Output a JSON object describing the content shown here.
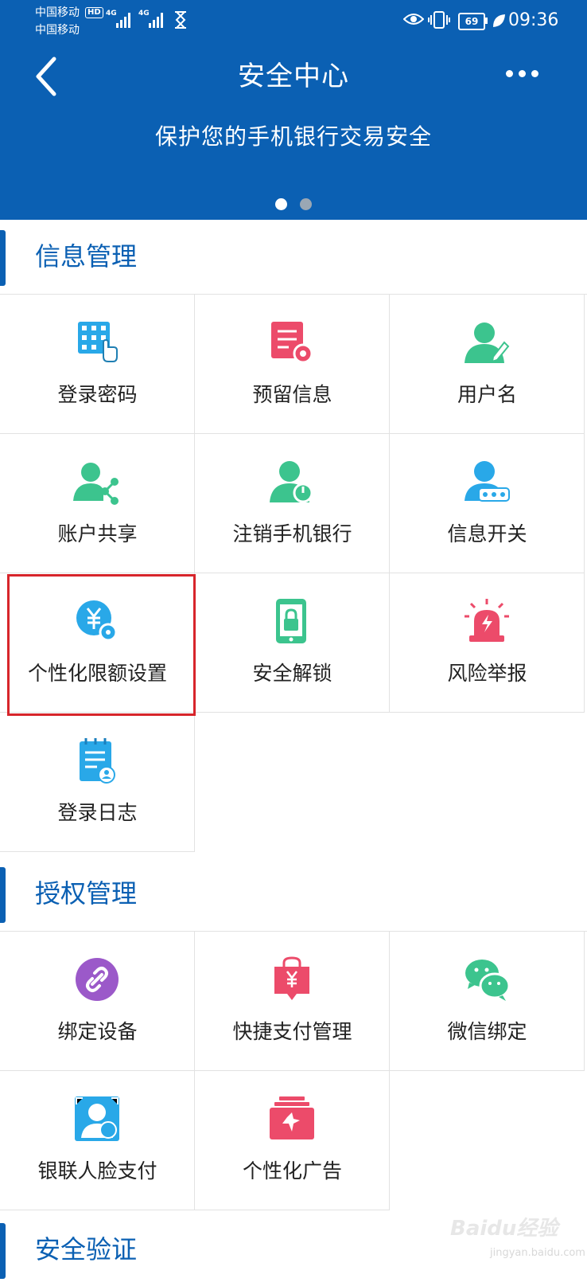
{
  "status_bar": {
    "carrier1": "中国移动",
    "carrier2": "中国移动",
    "hd": "HD",
    "net1": "4G",
    "net2": "4G",
    "battery": "69",
    "time": "09:36"
  },
  "header": {
    "title": "安全中心",
    "banner_text": "保护您的手机银行交易安全"
  },
  "sections": [
    {
      "title": "信息管理",
      "items": [
        {
          "label": "登录密码",
          "icon": "keypad-icon"
        },
        {
          "label": "预留信息",
          "icon": "document-settings-icon"
        },
        {
          "label": "用户名",
          "icon": "user-edit-icon"
        },
        {
          "label": "账户共享",
          "icon": "user-share-icon"
        },
        {
          "label": "注销手机银行",
          "icon": "user-power-icon"
        },
        {
          "label": "信息开关",
          "icon": "user-password-icon"
        },
        {
          "label": "个性化限额设置",
          "icon": "yuan-settings-icon"
        },
        {
          "label": "安全解锁",
          "icon": "phone-lock-icon"
        },
        {
          "label": "风险举报",
          "icon": "alarm-icon"
        },
        {
          "label": "登录日志",
          "icon": "log-notebook-icon"
        }
      ]
    },
    {
      "title": "授权管理",
      "items": [
        {
          "label": "绑定设备",
          "icon": "link-icon"
        },
        {
          "label": "快捷支付管理",
          "icon": "shopping-bag-icon"
        },
        {
          "label": "微信绑定",
          "icon": "wechat-icon"
        },
        {
          "label": "银联人脸支付",
          "icon": "face-pay-icon"
        },
        {
          "label": "个性化广告",
          "icon": "advertisement-icon"
        }
      ]
    },
    {
      "title": "安全验证",
      "items": []
    }
  ],
  "watermark": {
    "text": "Baidu经验",
    "sub": "jingyan.baidu.com"
  },
  "colors": {
    "header_bg": "#0b60b3",
    "accent": "#0b60b3",
    "highlight": "#d7252b"
  }
}
